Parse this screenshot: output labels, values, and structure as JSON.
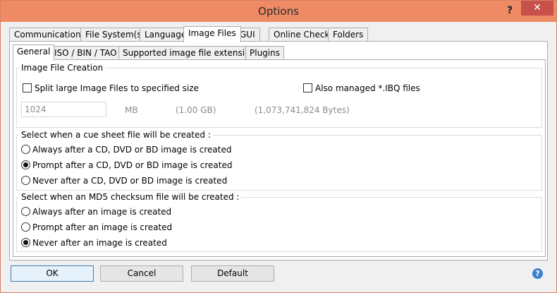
{
  "window": {
    "title": "Options",
    "help_glyph": "?",
    "close_glyph": "✕"
  },
  "tabs": [
    {
      "label": "Communication"
    },
    {
      "label": "File System(s)"
    },
    {
      "label": "Language"
    },
    {
      "label": "Image Files",
      "active": true
    },
    {
      "label": "GUI"
    },
    {
      "label": "Online Check"
    },
    {
      "label": "Folders"
    }
  ],
  "subtabs": [
    {
      "label": "General",
      "active": true
    },
    {
      "label": "ISO / BIN / TAO"
    },
    {
      "label": "Supported image file extensions"
    },
    {
      "label": "Plugins"
    }
  ],
  "image_file_creation": {
    "group_label": "Image File Creation",
    "split_label": "Split large Image Files to specified size",
    "split_checked": false,
    "ibq_label": "Also managed *.IBQ files",
    "ibq_checked": false,
    "size_value": "1024",
    "unit": "MB",
    "size_gb": "(1.00 GB)",
    "size_bytes": "(1,073,741,824 Bytes)"
  },
  "cue_sheet": {
    "group_label": "Select when a cue sheet file will be created :",
    "options": [
      {
        "label": "Always after a CD, DVD or BD image is created",
        "checked": false
      },
      {
        "label": "Prompt after a CD, DVD or BD image is created",
        "checked": true
      },
      {
        "label": "Never after a CD, DVD or BD image is created",
        "checked": false
      }
    ]
  },
  "md5": {
    "group_label": "Select when an MD5 checksum file will be created :",
    "options": [
      {
        "label": "Always after an image is created",
        "checked": false
      },
      {
        "label": "Prompt after an image is created",
        "checked": false
      },
      {
        "label": "Never after an image is created",
        "checked": true
      }
    ]
  },
  "buttons": {
    "ok": "OK",
    "cancel": "Cancel",
    "default": "Default",
    "help_glyph": "?"
  },
  "colors": {
    "titlebar": "#ee8a64",
    "close": "#c7504b",
    "help_icon": "#3a7fd0"
  }
}
